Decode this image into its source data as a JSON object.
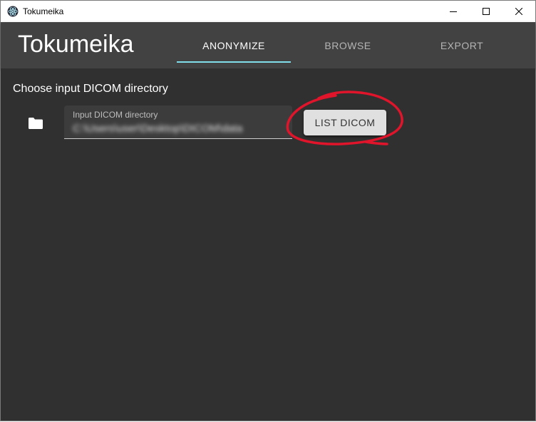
{
  "window": {
    "title": "Tokumeika",
    "controls": [
      "minimize-icon",
      "maximize-icon",
      "close-icon"
    ]
  },
  "appbar": {
    "title": "Tokumeika",
    "tabs": [
      {
        "label": "ANONYMIZE",
        "active": true
      },
      {
        "label": "BROWSE",
        "active": false
      },
      {
        "label": "EXPORT",
        "active": false
      }
    ]
  },
  "main": {
    "heading": "Choose input DICOM directory",
    "folder_icon": "folder-icon",
    "input": {
      "label": "Input DICOM directory",
      "value": "C:\\Users\\user\\Desktop\\DICOM\\data"
    },
    "list_button_label": "LIST DICOM"
  },
  "colors": {
    "background": "#303030",
    "appbar": "#424242",
    "tab_indicator": "#80deea",
    "annotation": "#e0142a",
    "button": "#e0e0e0"
  }
}
